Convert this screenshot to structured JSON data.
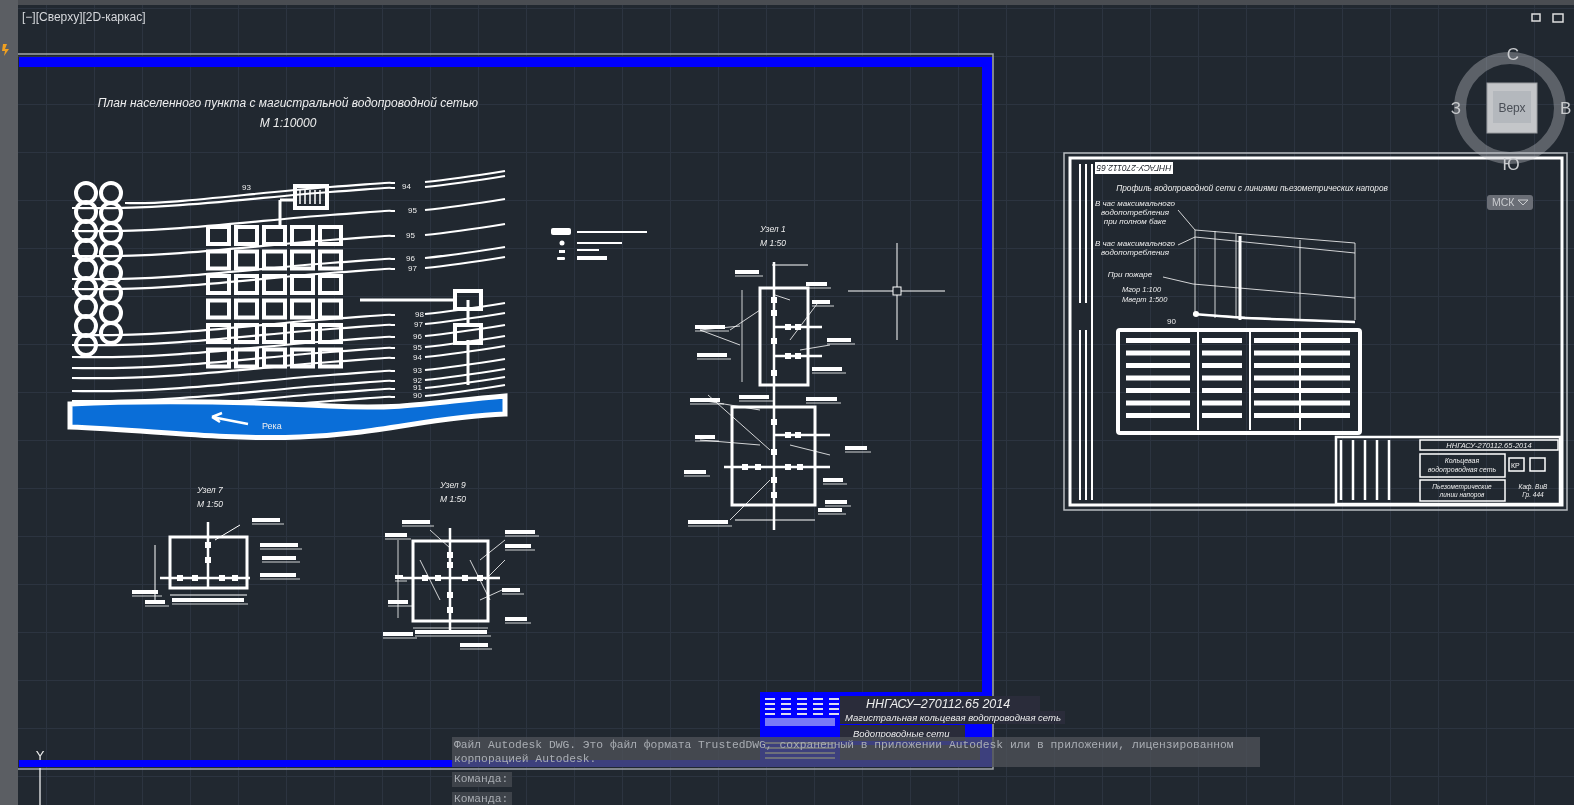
{
  "viewport": {
    "label": "[−][Сверху][2D-каркас]"
  },
  "sheet_1": {
    "title": "План населенного пункта с магистральной водопроводной сетью",
    "scale": "М 1:10000",
    "contour_labels": [
      "93",
      "94",
      "95",
      "95",
      "96",
      "97",
      "98",
      "97",
      "96",
      "95",
      "94",
      "93",
      "92",
      "91",
      "90"
    ],
    "river_label": "Река",
    "nodes": [
      {
        "title": "Узел 1",
        "scale": "М 1:50"
      },
      {
        "title": "Узел 7",
        "scale": "М 1:50"
      },
      {
        "title": "Узел 9",
        "scale": "М 1:50"
      }
    ],
    "title_block": {
      "code": "ННГАСУ–270112.65  2014",
      "name": "Магистральная кольцевая водопроводная сеть",
      "section": "Водопроводные сети"
    }
  },
  "sheet_2": {
    "code": "ННГАСУ-270112.65",
    "title": "Профиль водопроводной сети с линиями пьезометрических напоров",
    "line_labels": [
      {
        "lines": [
          "В час максимального",
          "водопотребления",
          "при полном баке"
        ]
      },
      {
        "lines": [
          "В час максимального",
          "водопотребления"
        ]
      },
      {
        "lines": [
          "При пожаре"
        ]
      }
    ],
    "scales": [
      "Мгор 1:100",
      "Мверт 1:500"
    ],
    "station_label": "90",
    "title_block": {
      "code": "ННГАСУ-270112.65-2014",
      "name_lines": [
        "Кольцевая",
        "водопроводная сеть"
      ],
      "stage": "КР",
      "sheet_name_lines": [
        "Пьезометрические",
        "линии напоров"
      ],
      "dept_lines": [
        "Каф. ВиВ",
        "Гр. 444"
      ]
    }
  },
  "view_cube": {
    "face": "Верх",
    "north": "С",
    "east": "В",
    "south": "Ю",
    "west": "З",
    "ucs": "МСК"
  },
  "ucs_icon": {
    "axis": "Y"
  },
  "command_line": {
    "message": "Файл Autodesk DWG. Это файл формата TrustedDWG, сохраненный в приложении Autodesk или в приложении, лицензированном корпорацией Autodesk.",
    "prompts": [
      "Команда:",
      "Команда:"
    ]
  }
}
